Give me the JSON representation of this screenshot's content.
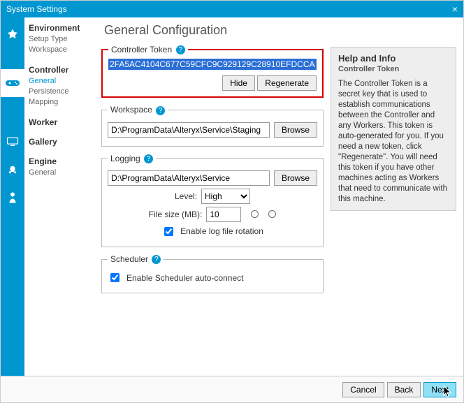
{
  "window": {
    "title": "System Settings",
    "close": "×"
  },
  "sidebar": {
    "environment": {
      "title": "Environment",
      "setup": "Setup Type",
      "workspace": "Workspace"
    },
    "controller": {
      "title": "Controller",
      "general": "General",
      "persistence": "Persistence",
      "mapping": "Mapping"
    },
    "worker": {
      "title": "Worker"
    },
    "gallery": {
      "title": "Gallery"
    },
    "engine": {
      "title": "Engine",
      "general": "General"
    }
  },
  "page": {
    "title": "General Configuration"
  },
  "token": {
    "legend": "Controller Token",
    "value": "2FA5AC4104C677C59CFC9C929129C28910EFDCCA",
    "hide": "Hide",
    "regenerate": "Regenerate"
  },
  "workspace": {
    "legend": "Workspace",
    "path": "D:\\ProgramData\\Alteryx\\Service\\Staging",
    "browse": "Browse"
  },
  "logging": {
    "legend": "Logging",
    "path": "D:\\ProgramData\\Alteryx\\Service",
    "browse": "Browse",
    "level_label": "Level:",
    "level_value": "High",
    "size_label": "File size (MB):",
    "size_value": "10",
    "rotation": "Enable log file rotation"
  },
  "scheduler": {
    "legend": "Scheduler",
    "enable": "Enable Scheduler auto-connect"
  },
  "help": {
    "title": "Help and Info",
    "section": "Controller Token",
    "body": "The Controller Token is a secret key that is used to establish communications between the Controller and any Workers. This token is auto-generated for you. If you need a new token, click \"Regenerate\". You will need this token if you have other machines acting as Workers that need to communicate with this machine."
  },
  "footer": {
    "cancel": "Cancel",
    "back": "Back",
    "next": "Next"
  }
}
